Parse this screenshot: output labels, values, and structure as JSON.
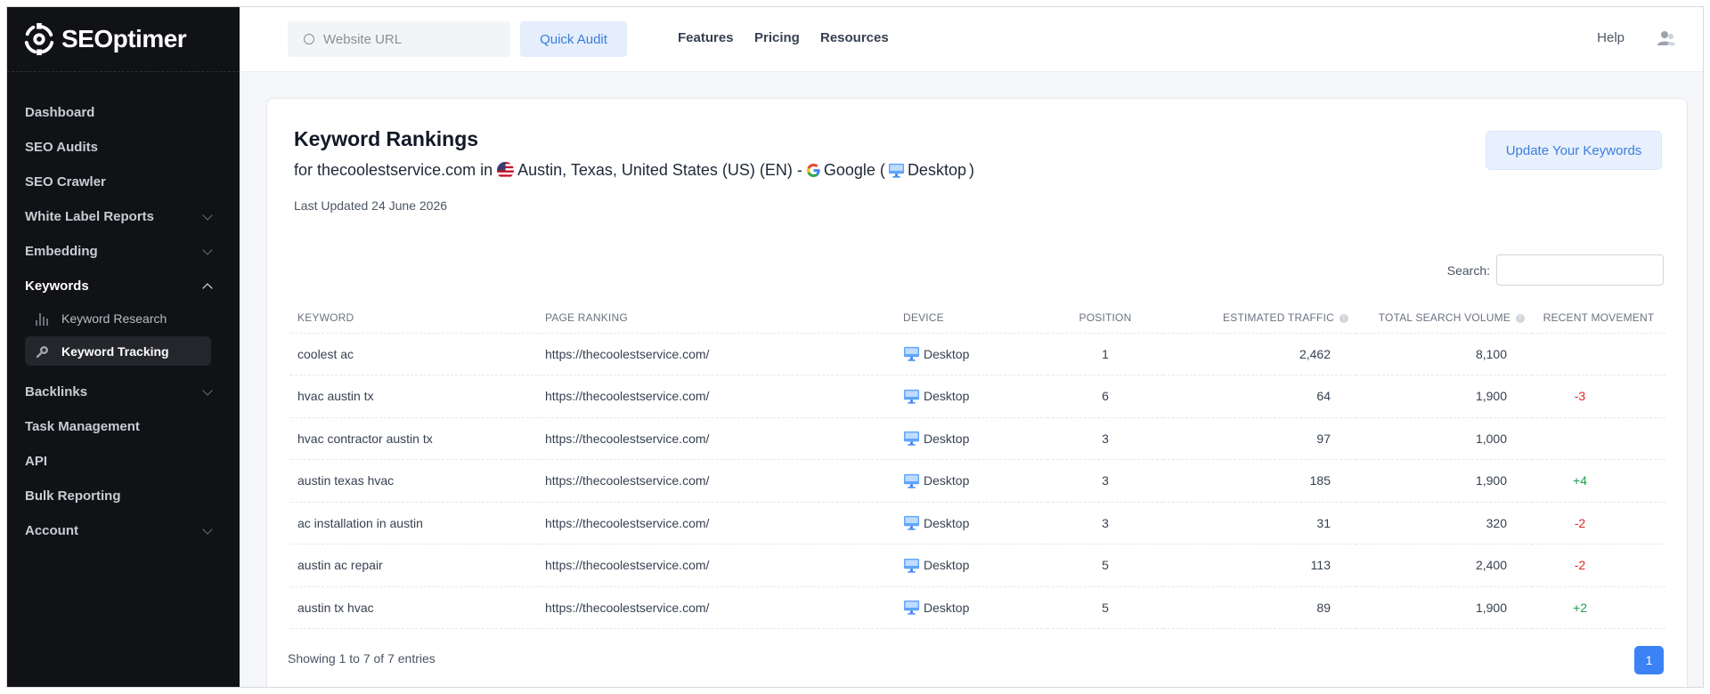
{
  "brand": {
    "name": "SEOptimer"
  },
  "sidebar": {
    "items": [
      {
        "label": "Dashboard",
        "chevron": "none"
      },
      {
        "label": "SEO Audits",
        "chevron": "none"
      },
      {
        "label": "SEO Crawler",
        "chevron": "none"
      },
      {
        "label": "White Label Reports",
        "chevron": "down"
      },
      {
        "label": "Embedding",
        "chevron": "down"
      },
      {
        "label": "Keywords",
        "chevron": "up",
        "expanded": true
      },
      {
        "label": "Backlinks",
        "chevron": "down"
      },
      {
        "label": "Task Management",
        "chevron": "none"
      },
      {
        "label": "API",
        "chevron": "none"
      },
      {
        "label": "Bulk Reporting",
        "chevron": "none"
      },
      {
        "label": "Account",
        "chevron": "down"
      }
    ],
    "keywords_sub": [
      {
        "label": "Keyword Research",
        "icon": "bar-chart-icon"
      },
      {
        "label": "Keyword Tracking",
        "icon": "magnifier-icon",
        "active": true
      }
    ]
  },
  "header": {
    "url_placeholder": "Website URL",
    "quick_audit": "Quick Audit",
    "nav": [
      "Features",
      "Pricing",
      "Resources"
    ],
    "help": "Help"
  },
  "report": {
    "title": "Keyword Rankings",
    "for_prefix": "for",
    "domain": "thecoolestservice.com",
    "in_word": "in",
    "location": "Austin, Texas, United States (US) (EN) -",
    "engine": "Google (",
    "device": "Desktop",
    "close_paren": ")",
    "last_updated": "Last Updated 24 June 2026",
    "update_button": "Update Your Keywords",
    "search_label": "Search:"
  },
  "table": {
    "columns": [
      "KEYWORD",
      "PAGE RANKING",
      "DEVICE",
      "POSITION",
      "ESTIMATED TRAFFIC",
      "TOTAL SEARCH VOLUME",
      "RECENT MOVEMENT"
    ],
    "rows": [
      {
        "keyword": "coolest ac",
        "page": "https://thecoolestservice.com/",
        "device": "Desktop",
        "position": "1",
        "traffic": "2,462",
        "volume": "8,100",
        "movement": ""
      },
      {
        "keyword": "hvac austin tx",
        "page": "https://thecoolestservice.com/",
        "device": "Desktop",
        "position": "6",
        "traffic": "64",
        "volume": "1,900",
        "movement": "-3"
      },
      {
        "keyword": "hvac contractor austin tx",
        "page": "https://thecoolestservice.com/",
        "device": "Desktop",
        "position": "3",
        "traffic": "97",
        "volume": "1,000",
        "movement": ""
      },
      {
        "keyword": "austin texas hvac",
        "page": "https://thecoolestservice.com/",
        "device": "Desktop",
        "position": "3",
        "traffic": "185",
        "volume": "1,900",
        "movement": "+4"
      },
      {
        "keyword": "ac installation in austin",
        "page": "https://thecoolestservice.com/",
        "device": "Desktop",
        "position": "3",
        "traffic": "31",
        "volume": "320",
        "movement": "-2"
      },
      {
        "keyword": "austin ac repair",
        "page": "https://thecoolestservice.com/",
        "device": "Desktop",
        "position": "5",
        "traffic": "113",
        "volume": "2,400",
        "movement": "-2"
      },
      {
        "keyword": "austin tx hvac",
        "page": "https://thecoolestservice.com/",
        "device": "Desktop",
        "position": "5",
        "traffic": "89",
        "volume": "1,900",
        "movement": "+2"
      }
    ],
    "showing": "Showing 1 to 7 of 7 entries",
    "page": "1"
  },
  "colors": {
    "accent": "#3b82f6",
    "negative": "#dc2626",
    "positive": "#16a34a",
    "sidebar_bg": "#111216"
  }
}
